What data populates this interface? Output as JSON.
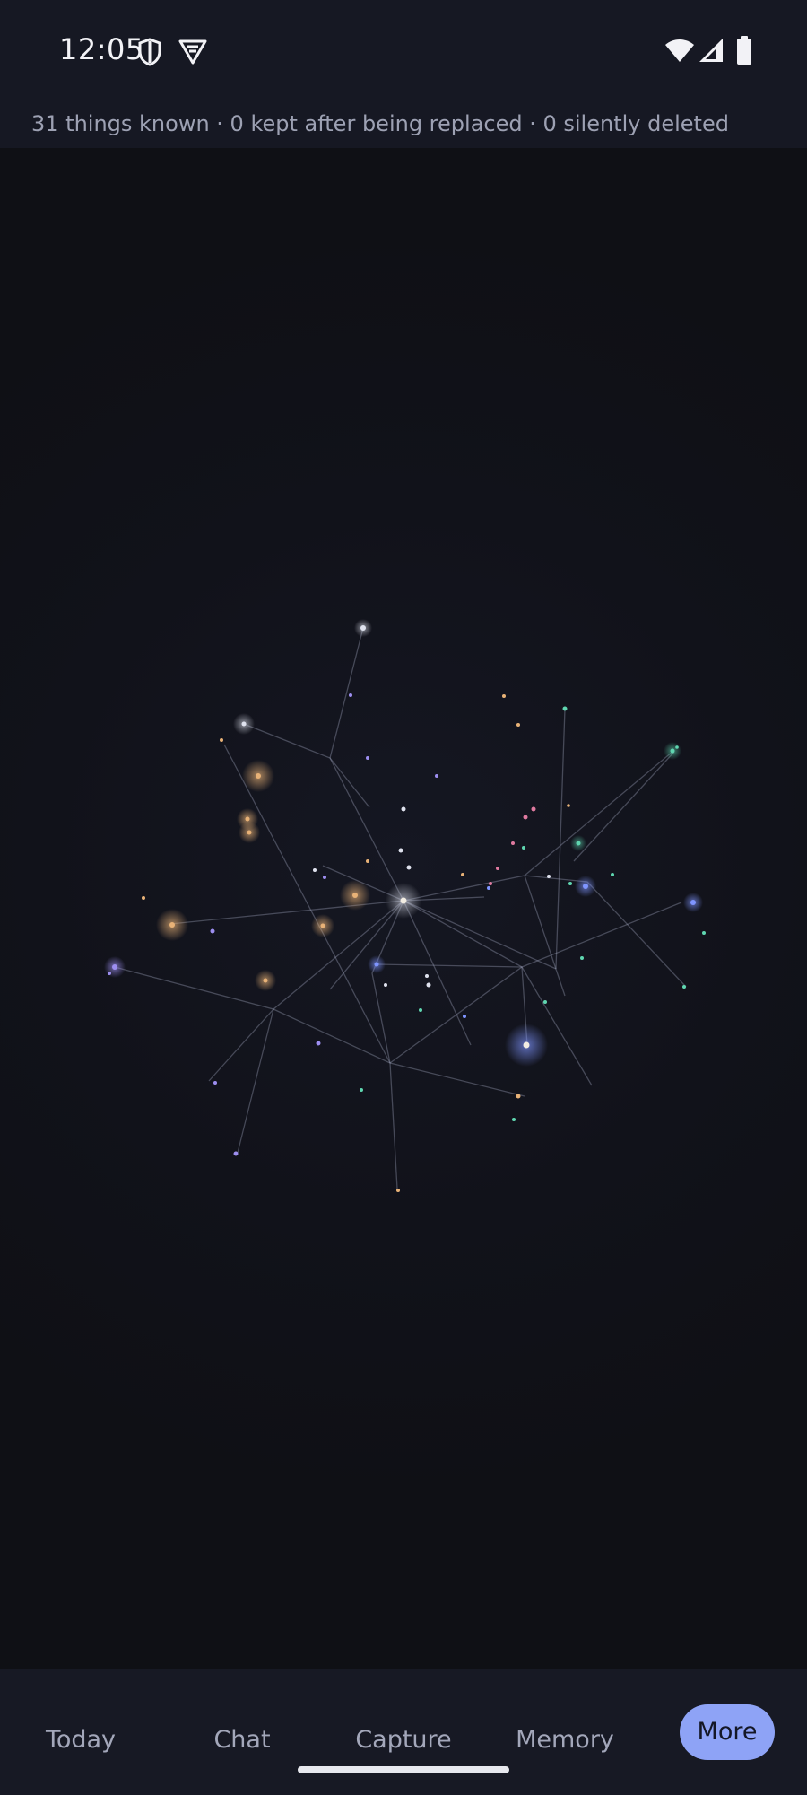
{
  "status_bar": {
    "time": "12:05",
    "icons": [
      "shield-icon",
      "vpn-icon",
      "wifi-icon",
      "signal-icon",
      "battery-icon"
    ]
  },
  "summary": {
    "text": "31 things known · 0 kept after being replaced · 0 silently deleted"
  },
  "memory_graph": {
    "description_nodes": "network of memory nodes",
    "colors": {
      "gold": "#e8b277",
      "violet": "#9d8ef0",
      "teal": "#5fd6b0",
      "pink": "#e07aa0",
      "blue": "#7f95ff",
      "white": "#dfe2ee"
    }
  },
  "nav": {
    "items": [
      {
        "label": "Today"
      },
      {
        "label": "Chat"
      },
      {
        "label": "Capture"
      },
      {
        "label": "Memory"
      },
      {
        "label": "More",
        "selected": true
      }
    ],
    "accent": "#8ea3f6"
  }
}
